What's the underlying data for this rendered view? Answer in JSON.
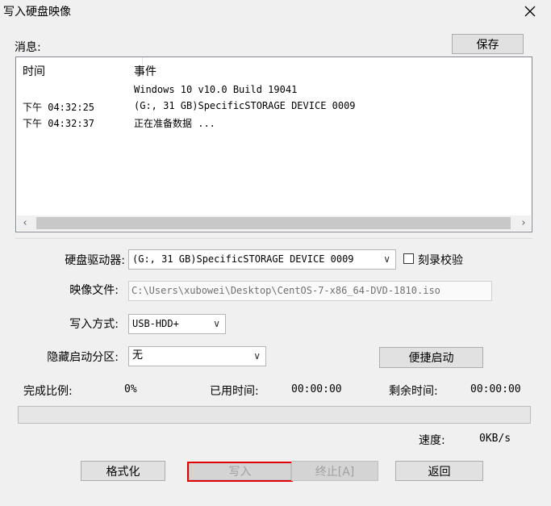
{
  "window": {
    "title": "写入硬盘映像"
  },
  "messages": {
    "label": "消息:",
    "save_button": "保存",
    "headers": {
      "time": "时间",
      "event": "事件"
    },
    "rows": [
      {
        "time": "",
        "event": "Windows 10 v10.0 Build 19041"
      },
      {
        "time": "下午 04:32:25",
        "event": "(G:, 31 GB)SpecificSTORAGE DEVICE  0009"
      },
      {
        "time": "下午 04:32:37",
        "event": "正在准备数据 ..."
      }
    ]
  },
  "form": {
    "drive_label": "硬盘驱动器:",
    "drive_value": "(G:, 31 GB)SpecificSTORAGE DEVICE  0009",
    "verify_label": "刻录校验",
    "verify_checked": false,
    "image_label": "映像文件:",
    "image_value": "C:\\Users\\xubowei\\Desktop\\CentOS-7-x86_64-DVD-1810.iso",
    "mode_label": "写入方式:",
    "mode_value": "USB-HDD+",
    "hidden_label": "隐藏启动分区:",
    "hidden_value": "无",
    "quick_boot_button": "便捷启动"
  },
  "progress": {
    "done_label": "完成比例:",
    "done_value": "0%",
    "elapsed_label": "已用时间:",
    "elapsed_value": "00:00:00",
    "remaining_label": "剩余时间:",
    "remaining_value": "00:00:00",
    "fraction": 0,
    "speed_label": "速度:",
    "speed_value": "0KB/s"
  },
  "buttons": {
    "format": "格式化",
    "write": "写入",
    "stop": "终止[A]",
    "back": "返回"
  },
  "colors": {
    "highlight": "#e00000"
  }
}
